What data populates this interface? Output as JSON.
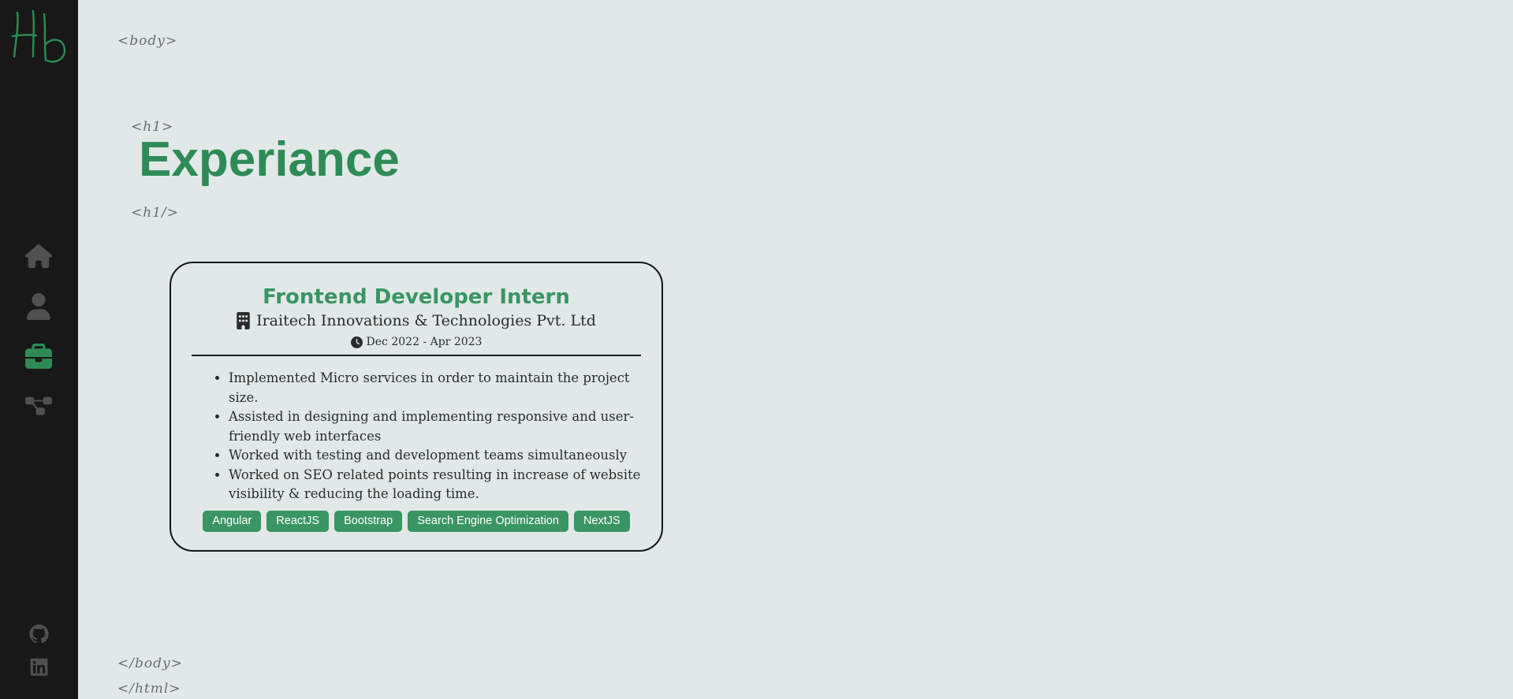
{
  "brand": {
    "logo_text": "Hb",
    "accent_color": "#2e8b57"
  },
  "sidebar": {
    "nav_items": [
      {
        "icon": "home-icon",
        "active": false
      },
      {
        "icon": "user-icon",
        "active": false
      },
      {
        "icon": "briefcase-icon",
        "active": true
      },
      {
        "icon": "sitemap-icon",
        "active": false
      }
    ],
    "social": [
      {
        "icon": "github-icon"
      },
      {
        "icon": "linkedin-icon"
      }
    ]
  },
  "tags": {
    "body_open": "<body>",
    "h1_open": "<h1>",
    "h1_close": "<h1/>",
    "body_close": "</body>",
    "html_close": "</html>"
  },
  "page": {
    "title": "Experiance"
  },
  "experience": [
    {
      "role": "Frontend Developer Intern",
      "company": "Iraitech Innovations & Technologies Pvt. Ltd",
      "dates": "Dec 2022 - Apr 2023",
      "duties": [
        "Implemented Micro services in order to maintain the project size.",
        "Assisted in designing and implementing responsive and user-friendly web interfaces",
        "Worked with testing and development teams simultaneously",
        "Worked on SEO related points resulting in increase of website visibility & reducing the loading time."
      ],
      "skills": [
        "Angular",
        "ReactJS",
        "Bootstrap",
        "Search Engine Optimization",
        "NextJS"
      ]
    }
  ]
}
